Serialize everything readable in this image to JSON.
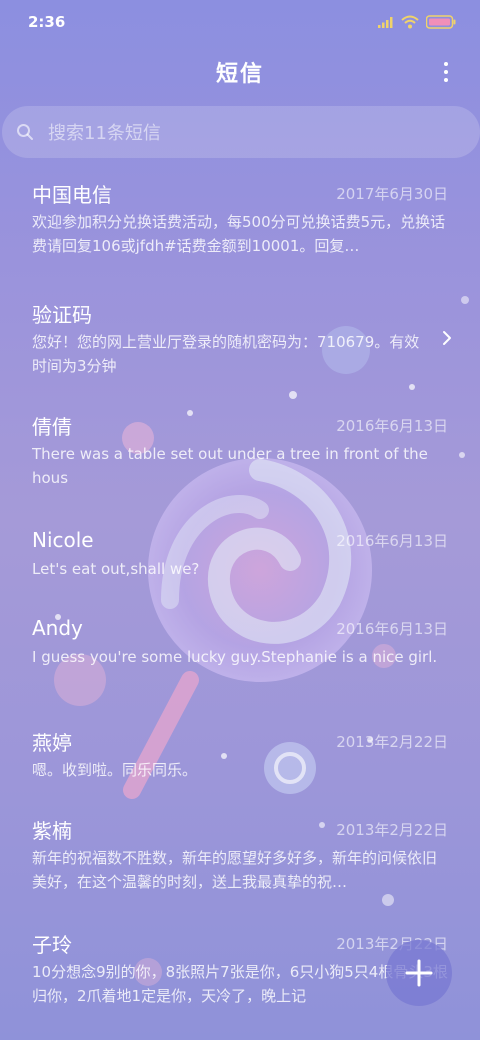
{
  "status": {
    "time": "2:36"
  },
  "header": {
    "title": "短信"
  },
  "search": {
    "placeholder": "搜索11条短信"
  },
  "messages": [
    {
      "sender": "中国电信",
      "date": "2017年6月30日",
      "preview": "欢迎参加积分兑换话费活动，每500分可兑换话费5元，兑换话费请回复106或jfdh#话费金额到10001。回复…"
    },
    {
      "sender": "验证码",
      "date": "",
      "preview": "您好！您的网上营业厅登录的随机密码为：710679。有效时间为3分钟"
    },
    {
      "sender": "倩倩",
      "date": "2016年6月13日",
      "preview": "There was a table set out under a tree in front of the hous"
    },
    {
      "sender": "Nicole",
      "date": "2016年6月13日",
      "preview": "Let's eat out,shall we?"
    },
    {
      "sender": "Andy",
      "date": "2016年6月13日",
      "preview": "I guess you're some lucky guy.Stephanie is a nice girl."
    },
    {
      "sender": "燕婷",
      "date": "2013年2月22日",
      "preview": "嗯。收到啦。同乐同乐。"
    },
    {
      "sender": "紫楠",
      "date": "2013年2月22日",
      "preview": "新年的祝福数不胜数，新年的愿望好多好多，新年的问候依旧美好，在这个温馨的时刻，送上我最真挚的祝…"
    },
    {
      "sender": "子玲",
      "date": "2013年2月22日",
      "preview": "10分想念9别的你，8张照片7张是你，6只小狗5只4根骨头3根归你，2爪着地1定是你，天冷了，晚上记"
    }
  ]
}
